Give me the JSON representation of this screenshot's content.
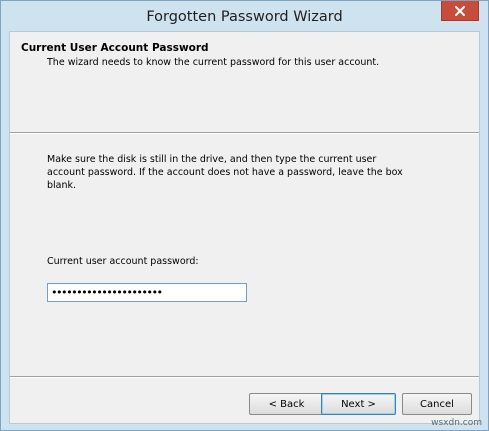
{
  "window": {
    "title": "Forgotten Password Wizard",
    "close_icon": "close-icon",
    "accent_color": "#c74c3c"
  },
  "header": {
    "title": "Current User Account Password",
    "subtitle": "The wizard needs to know the current password for this user account."
  },
  "body": {
    "instructions": "Make sure the disk is still in the drive, and then type the current user account password. If the account does not have a password, leave the box blank.",
    "password_label": "Current user account password:",
    "password_value": "••••••••••••••••••••••"
  },
  "buttons": {
    "back": "< Back",
    "next": "Next >",
    "cancel": "Cancel"
  },
  "watermark": "wsxdn.com"
}
